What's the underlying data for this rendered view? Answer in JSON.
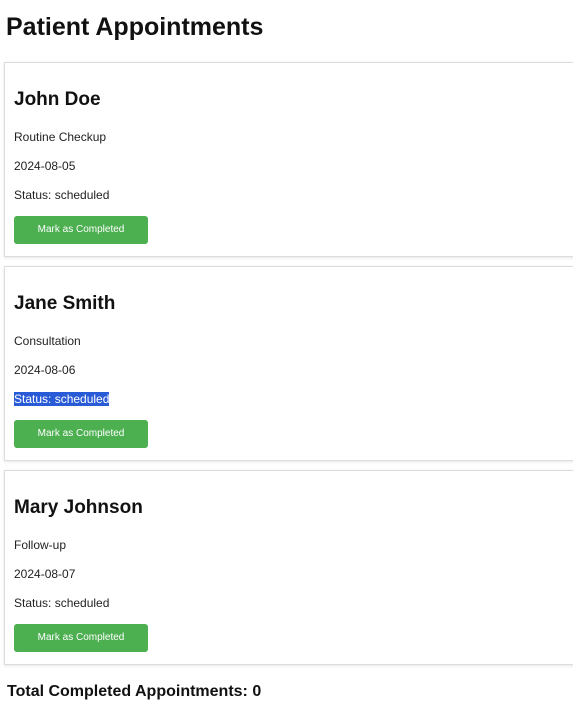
{
  "page": {
    "title": "Patient Appointments"
  },
  "appointments": [
    {
      "name": "John Doe",
      "type": "Routine Checkup",
      "date": "2024-08-05",
      "status": "Status: scheduled",
      "button_label": "Mark as Completed"
    },
    {
      "name": "Jane Smith",
      "type": "Consultation",
      "date": "2024-08-06",
      "status": "Status: scheduled",
      "status_selected": true,
      "button_label": "Mark as Completed"
    },
    {
      "name": "Mary Johnson",
      "type": "Follow-up",
      "date": "2024-08-07",
      "status": "Status: scheduled",
      "button_label": "Mark as Completed"
    }
  ],
  "summary": {
    "total_completed": "Total Completed Appointments: 0"
  },
  "colors": {
    "button": "#4caf50",
    "selection": "#2a5bd7"
  }
}
